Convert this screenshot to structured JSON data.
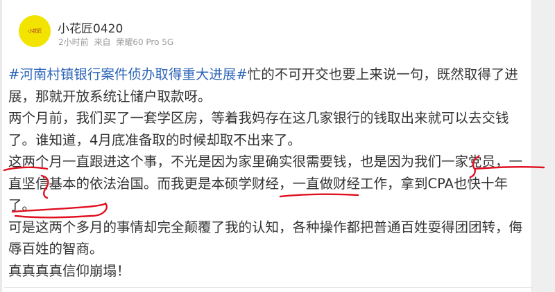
{
  "post": {
    "author": {
      "name": "小花匠0420",
      "avatar_text": "小花匠",
      "avatar_color": "#f3e400"
    },
    "meta": {
      "time": "2小时前",
      "source_prefix": "来自",
      "device": "荣耀60 Pro 5G"
    },
    "paragraphs": [
      {
        "hashtag": "#河南村镇银行案件侦办取得重大进展#",
        "text": "忙的不可开交也要上来说一句，既然取得了进展，那就开放系统让储户取款呀。"
      },
      {
        "text": "两个月前，我们买了一套学区房，等着我妈存在这几家银行的钱取出来就可以去交钱了。谁知道，4月底准备取的时候却取不出来了。"
      },
      {
        "text": "这两个月一直跟进这个事，不光是因为家里确实很需要钱，也是因为我们一家党员，一直坚信基本的依法治国。而我更是本硕学财经，一直做财经工作，拿到CPA也快十年了。"
      },
      {
        "text": "可是这两个多月的事情却完全颠覆了我的认知，各种操作都把普通百姓耍得团团转，侮辱百姓的智商。"
      },
      {
        "text": "真真真真信仰崩塌！"
      }
    ],
    "hashtag_color": "#2c64b8",
    "annotation_color": "#e01020"
  }
}
